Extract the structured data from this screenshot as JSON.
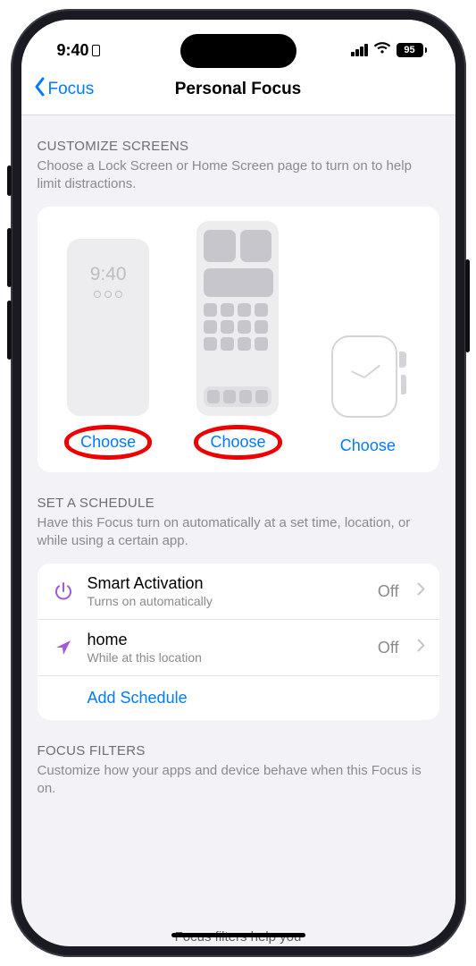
{
  "status": {
    "time": "9:40",
    "battery": "95"
  },
  "nav": {
    "back": "Focus",
    "title": "Personal Focus"
  },
  "customize": {
    "heading": "CUSTOMIZE SCREENS",
    "desc": "Choose a Lock Screen or Home Screen page to turn on to help limit distractions.",
    "lock_time": "9:40",
    "choose1": "Choose",
    "choose2": "Choose",
    "choose3": "Choose"
  },
  "schedule": {
    "heading": "SET A SCHEDULE",
    "desc": "Have this Focus turn on automatically at a set time, location, or while using a certain app.",
    "smart_title": "Smart Activation",
    "smart_sub": "Turns on automatically",
    "smart_val": "Off",
    "home_title": "home",
    "home_sub": "While at this location",
    "home_val": "Off",
    "add": "Add Schedule"
  },
  "filters": {
    "heading": "FOCUS FILTERS",
    "desc": "Customize how your apps and device behave when this Focus is on.",
    "cutoff": "Focus filters help you"
  }
}
